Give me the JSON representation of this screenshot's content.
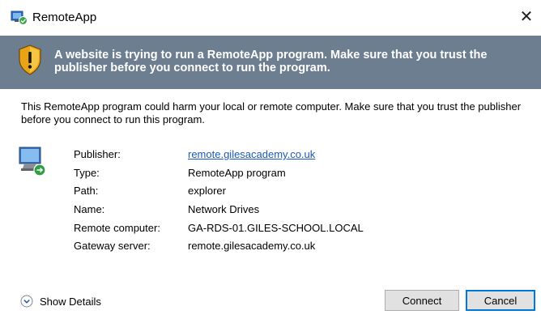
{
  "window": {
    "title": "RemoteApp",
    "close_glyph": "✕"
  },
  "banner": {
    "icon": "shield-warning-icon",
    "text": "A website is trying to run a RemoteApp program. Make sure that you trust the publisher before you connect to run the program."
  },
  "description": "This RemoteApp program could harm your local or remote computer. Make sure that you trust the publisher before you connect to run this program.",
  "details": {
    "icon": "remote-computer-icon",
    "rows": [
      {
        "label": "Publisher:",
        "value": "remote.gilesacademy.co.uk",
        "is_link": true
      },
      {
        "label": "Type:",
        "value": "RemoteApp program",
        "is_link": false
      },
      {
        "label": "Path:",
        "value": "explorer",
        "is_link": false
      },
      {
        "label": "Name:",
        "value": "Network Drives",
        "is_link": false
      },
      {
        "label": "Remote computer:",
        "value": "GA-RDS-01.GILES-SCHOOL.LOCAL",
        "is_link": false
      },
      {
        "label": "Gateway server:",
        "value": "remote.gilesacademy.co.uk",
        "is_link": false
      }
    ]
  },
  "footer": {
    "show_details_label": "Show Details",
    "connect_label": "Connect",
    "cancel_label": "Cancel"
  },
  "colors": {
    "banner_bg": "#6d7e90",
    "link": "#1a5bb8",
    "focus_border": "#0078d7",
    "button_bg": "#e1e1e1"
  }
}
